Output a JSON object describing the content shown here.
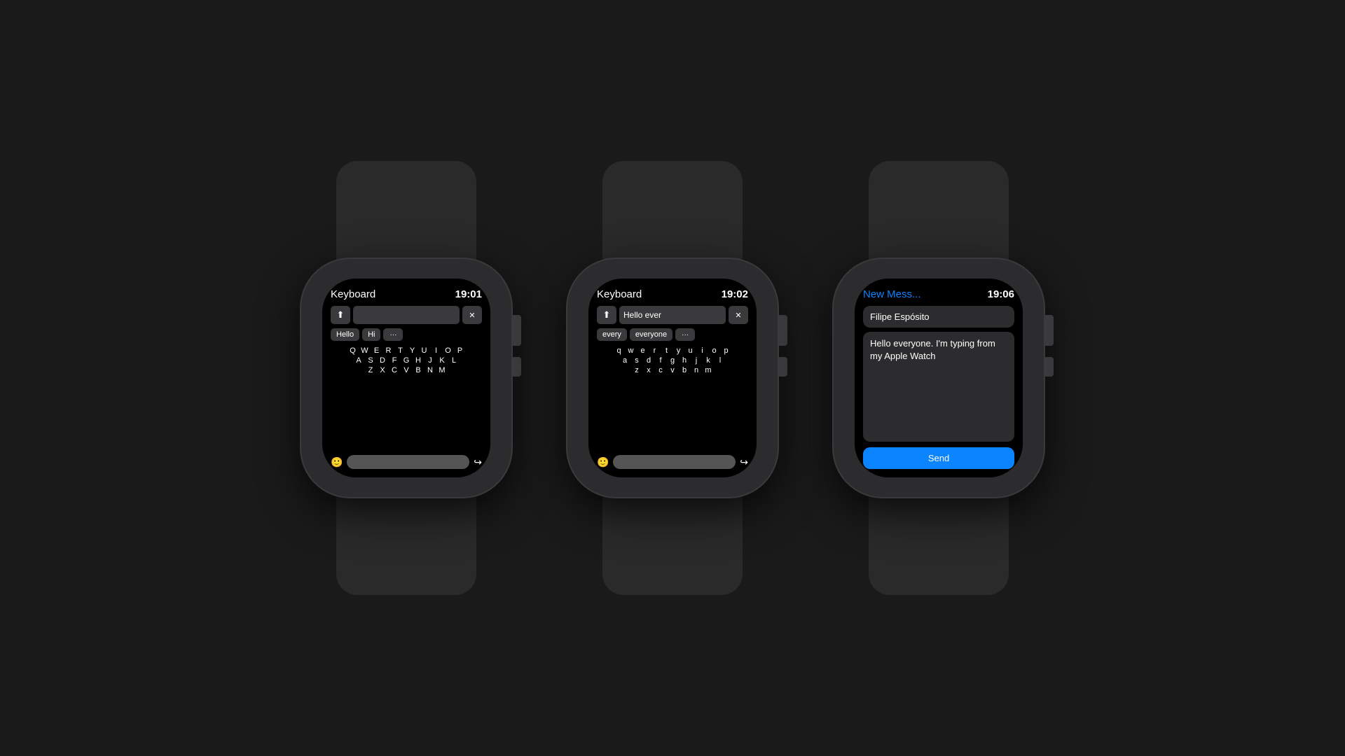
{
  "watches": [
    {
      "id": "watch1",
      "screen_title": "Keyboard",
      "screen_time": "19:01",
      "type": "keyboard-empty",
      "input_text": "",
      "suggestions": [
        "Hello",
        "Hi",
        "···"
      ],
      "keyboard_rows": [
        [
          "Q",
          "W",
          "E",
          "R",
          "T",
          "Y",
          "U",
          "I",
          "O",
          "P"
        ],
        [
          "A",
          "S",
          "D",
          "F",
          "G",
          "H",
          "J",
          "K",
          "L"
        ],
        [
          "Z",
          "X",
          "C",
          "V",
          "B",
          "N",
          "M"
        ]
      ]
    },
    {
      "id": "watch2",
      "screen_title": "Keyboard",
      "screen_time": "19:02",
      "type": "keyboard-typing",
      "input_text": "Hello ever",
      "suggestions": [
        "every",
        "everyone",
        "···"
      ],
      "keyboard_rows": [
        [
          "q",
          "w",
          "e",
          "r",
          "t",
          "y",
          "u",
          "i",
          "o",
          "p"
        ],
        [
          "a",
          "s",
          "d",
          "f",
          "g",
          "h",
          "j",
          "k",
          "l"
        ],
        [
          "z",
          "x",
          "c",
          "v",
          "b",
          "n",
          "m"
        ]
      ]
    },
    {
      "id": "watch3",
      "screen_title": "New Mess...",
      "screen_time": "19:06",
      "type": "message",
      "contact": "Filipe Espósito",
      "message_text": "Hello everyone. I'm typing from my Apple Watch",
      "send_label": "Send"
    }
  ]
}
